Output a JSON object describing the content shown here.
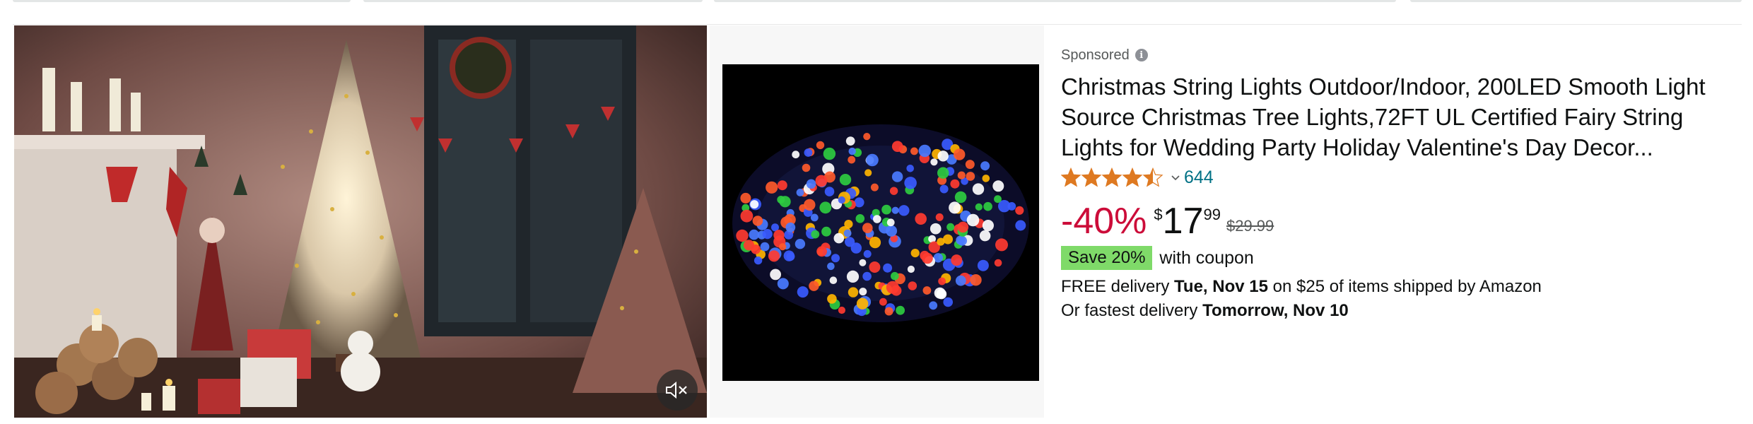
{
  "product": {
    "sponsored_label": "Sponsored",
    "title": "Christmas String Lights Outdoor/Indoor, 200LED Smooth Light Source Christmas Tree Lights,72FT UL Certified Fairy String Lights for Wedding Party Holiday Valentine's Day Decor...",
    "rating": {
      "stars": 4.5,
      "count": "644"
    },
    "price": {
      "discount": "-40%",
      "currency": "$",
      "whole": "17",
      "fraction": "99",
      "list_price": "$29.99"
    },
    "coupon": {
      "badge": "Save 20%",
      "text": "with coupon"
    },
    "delivery": {
      "free_prefix": "FREE delivery ",
      "free_date": "Tue, Nov 15",
      "free_suffix": " on $25 of items shipped by Amazon",
      "fast_prefix": "Or fastest delivery ",
      "fast_date": "Tomorrow, Nov 10"
    }
  },
  "icons": {
    "info": "info-icon",
    "mute": "speaker-muted-icon",
    "star": "star-icon",
    "chevron": "chevron-down-icon"
  },
  "colors": {
    "discount": "#cc0c39",
    "rating_link": "#007185",
    "star": "#de7921",
    "coupon_badge": "#7fda69"
  }
}
